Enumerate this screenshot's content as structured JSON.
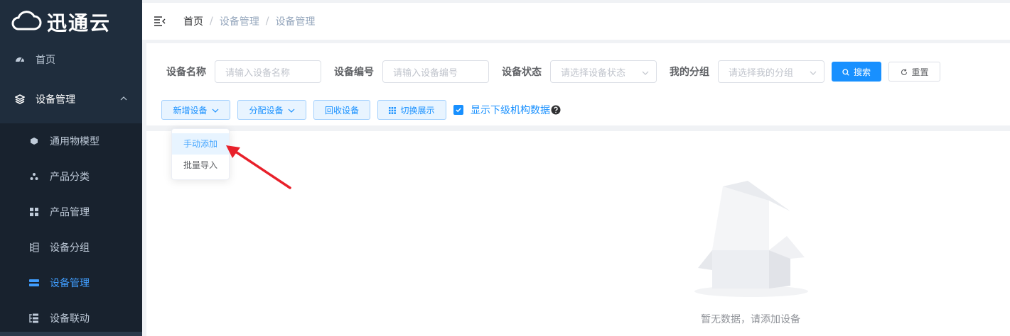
{
  "app": {
    "logo_text": "迅通云"
  },
  "sidebar": {
    "items": [
      {
        "label": "首页",
        "icon": "dashboard-icon"
      },
      {
        "label": "设备管理",
        "icon": "layers-icon",
        "expanded": true
      }
    ],
    "submenu": [
      {
        "label": "通用物模型",
        "icon": "cube-icon"
      },
      {
        "label": "产品分类",
        "icon": "cluster-icon"
      },
      {
        "label": "产品管理",
        "icon": "grid-icon"
      },
      {
        "label": "设备分组",
        "icon": "tree-icon"
      },
      {
        "label": "设备管理",
        "icon": "server-icon",
        "active": true
      },
      {
        "label": "设备联动",
        "icon": "list-tree-icon"
      }
    ]
  },
  "header": {
    "breadcrumb": [
      "首页",
      "设备管理",
      "设备管理"
    ],
    "separator": "/"
  },
  "filters": {
    "device_name": {
      "label": "设备名称",
      "placeholder": "请输入设备名称"
    },
    "device_code": {
      "label": "设备编号",
      "placeholder": "请输入设备编号"
    },
    "device_status": {
      "label": "设备状态",
      "placeholder": "请选择设备状态"
    },
    "my_group": {
      "label": "我的分组",
      "placeholder": "请选择我的分组"
    },
    "search_label": "搜索",
    "reset_label": "重置"
  },
  "actions": {
    "add_device": "新增设备",
    "assign_device": "分配设备",
    "recycle_device": "回收设备",
    "switch_view": "切换展示",
    "show_sub_org": "显示下级机构数据",
    "show_sub_org_checked": true
  },
  "dropdown": {
    "items": [
      "手动添加",
      "批量导入"
    ]
  },
  "empty": {
    "text": "暂无数据，请添加设备"
  },
  "colors": {
    "primary": "#1890ff",
    "sidebar_bg": "#1f2d3d",
    "active": "#409eff",
    "arrow": "#e8202a"
  }
}
